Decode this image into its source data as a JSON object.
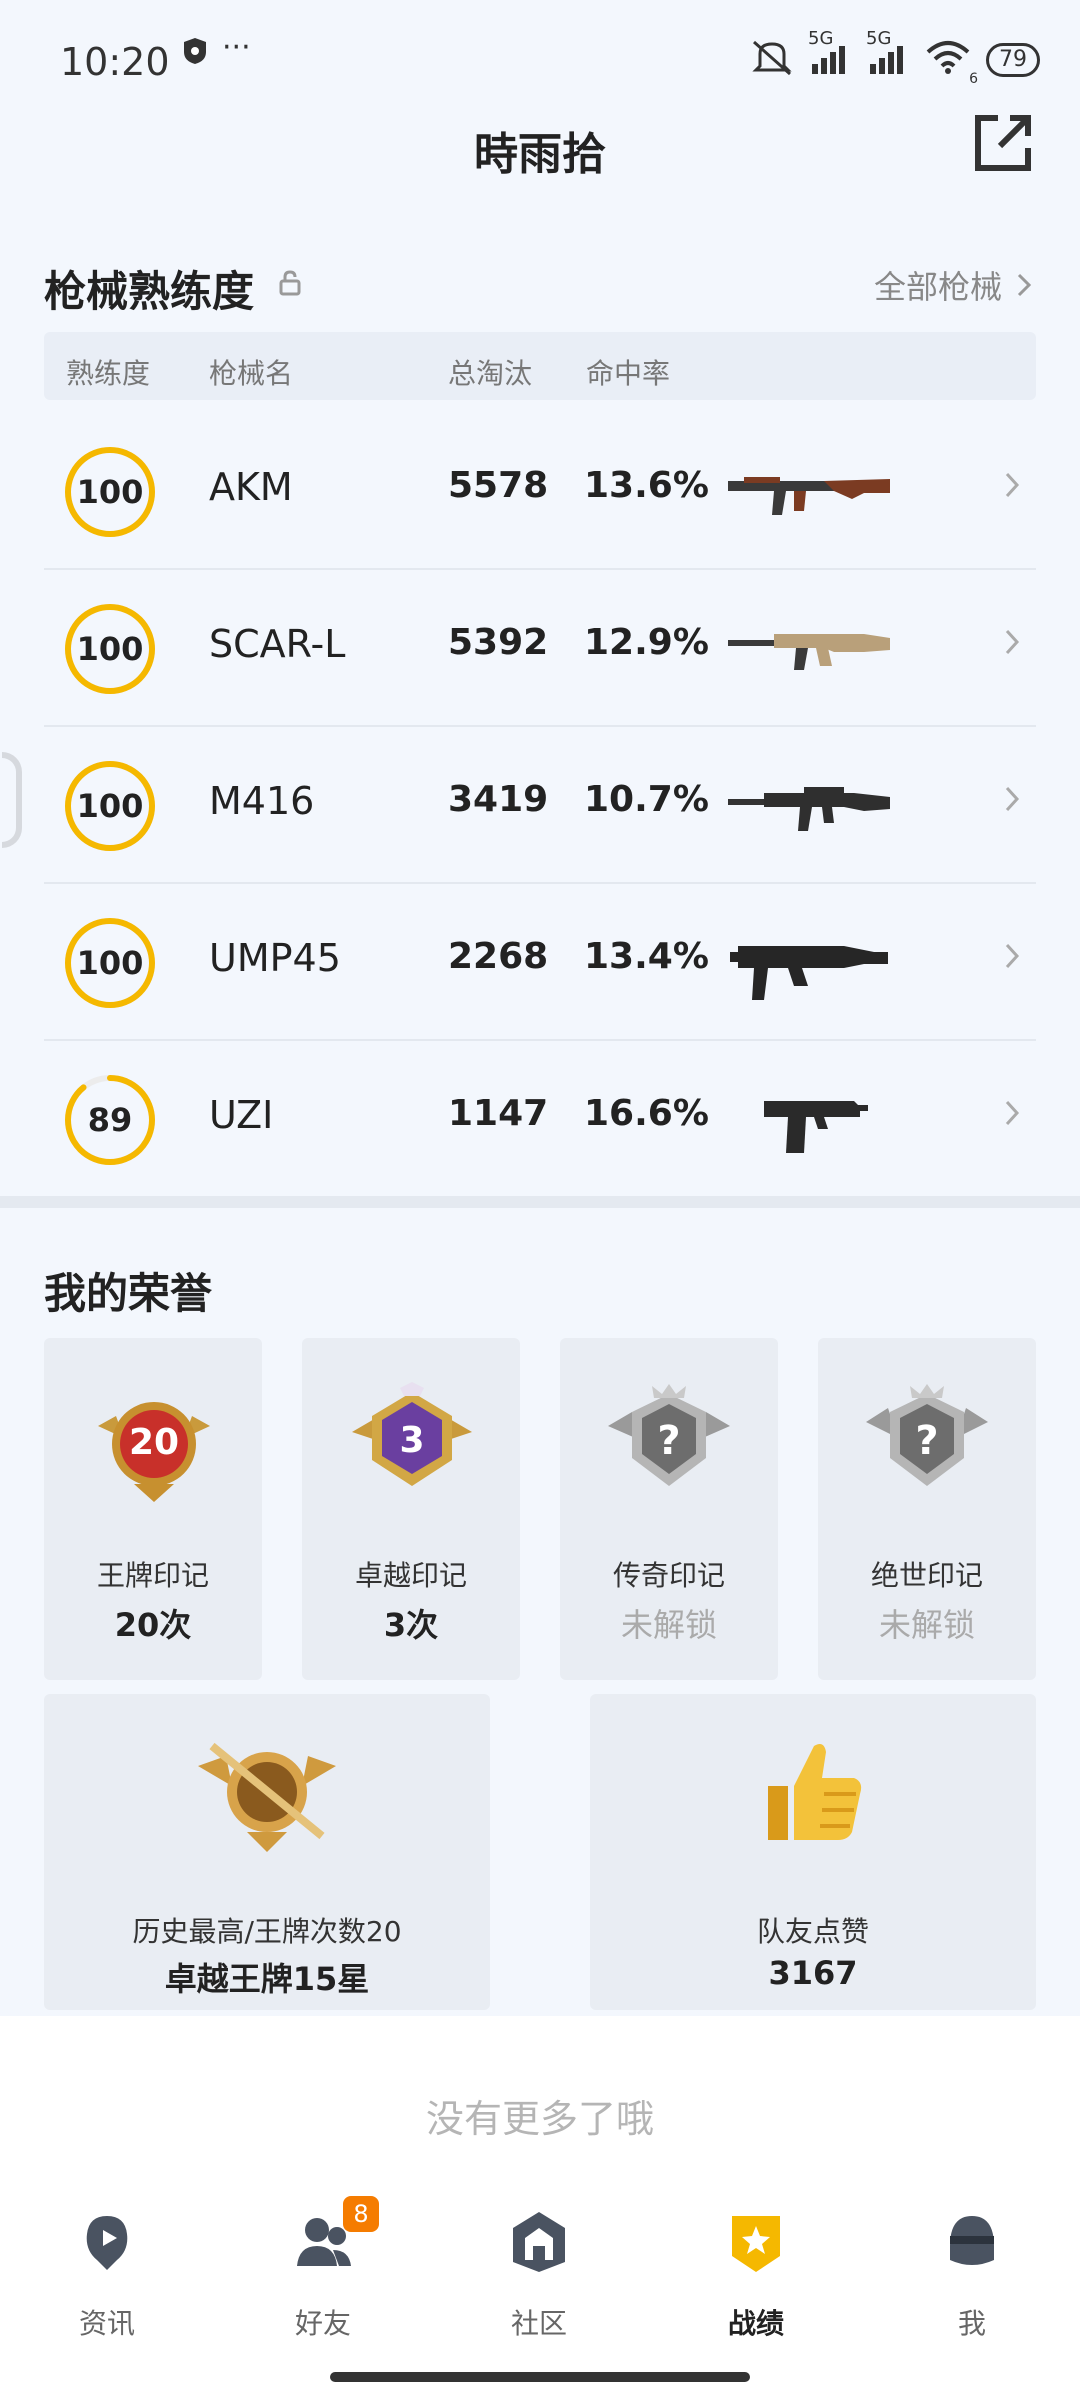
{
  "status_bar": {
    "time": "10:20",
    "dots": "···",
    "net1": "5G",
    "net2": "5G",
    "wifi_sub": "6",
    "battery": "79"
  },
  "header": {
    "title": "時雨拾"
  },
  "weapons": {
    "title": "枪械熟练度",
    "all_link": "全部枪械",
    "columns": [
      "熟练度",
      "枪械名",
      "总淘汰",
      "命中率"
    ],
    "rows": [
      {
        "proficiency": "100",
        "proficiency_pct": 100,
        "name": "AKM",
        "kills": "5578",
        "hit_rate": "13.6%",
        "gun_icon": "akm-rifle-icon"
      },
      {
        "proficiency": "100",
        "proficiency_pct": 100,
        "name": "SCAR-L",
        "kills": "5392",
        "hit_rate": "12.9%",
        "gun_icon": "scar-rifle-icon"
      },
      {
        "proficiency": "100",
        "proficiency_pct": 100,
        "name": "M416",
        "kills": "3419",
        "hit_rate": "10.7%",
        "gun_icon": "m416-rifle-icon"
      },
      {
        "proficiency": "100",
        "proficiency_pct": 100,
        "name": "UMP45",
        "kills": "2268",
        "hit_rate": "13.4%",
        "gun_icon": "ump45-smg-icon"
      },
      {
        "proficiency": "89",
        "proficiency_pct": 89,
        "name": "UZI",
        "kills": "1147",
        "hit_rate": "16.6%",
        "gun_icon": "uzi-smg-icon"
      }
    ]
  },
  "honors": {
    "title": "我的荣誉",
    "marks": [
      {
        "label": "王牌印记",
        "value": "20次",
        "badge_text": "20",
        "icon": "ace-mark-badge-icon"
      },
      {
        "label": "卓越印记",
        "value": "3次",
        "badge_text": "3",
        "icon": "excellence-mark-badge-icon"
      },
      {
        "label": "传奇印记",
        "value": "未解锁",
        "badge_text": "?",
        "icon": "legend-mark-badge-icon"
      },
      {
        "label": "绝世印记",
        "value": "未解锁",
        "badge_text": "?",
        "icon": "peerless-mark-badge-icon"
      }
    ],
    "best": {
      "label": "历史最高/王牌次数20",
      "value": "卓越王牌15星",
      "icon": "rank-emblem-icon"
    },
    "likes": {
      "label": "队友点赞",
      "value": "3167",
      "icon": "thumbs-up-icon"
    }
  },
  "footer_message": "没有更多了哦",
  "nav": {
    "items": [
      {
        "label": "资讯",
        "icon": "news-icon"
      },
      {
        "label": "好友",
        "icon": "friends-icon",
        "badge": "8"
      },
      {
        "label": "社区",
        "icon": "community-icon"
      },
      {
        "label": "战绩",
        "icon": "record-icon",
        "active": true
      },
      {
        "label": "我",
        "icon": "profile-icon"
      }
    ]
  },
  "colors": {
    "accent_yellow": "#f5b800",
    "bg": "#f3f7fd",
    "badge_orange": "#f57c00"
  }
}
